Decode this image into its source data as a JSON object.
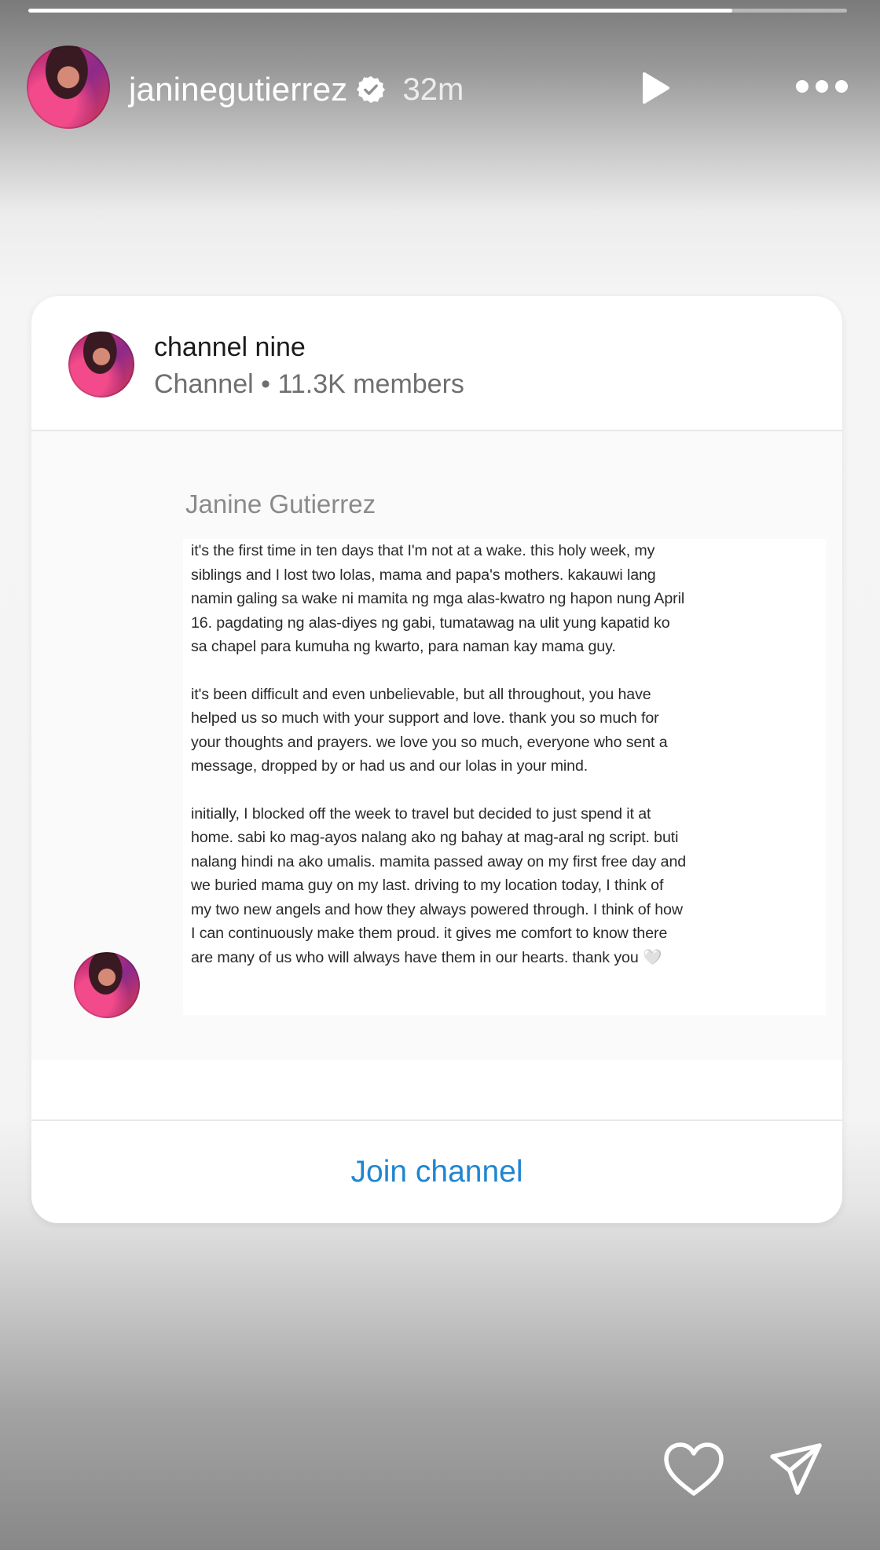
{
  "story": {
    "progress": 0.86,
    "username": "janinegutierrez",
    "verified": true,
    "time": "32m",
    "controls": {
      "play_icon": "play-icon",
      "more_icon": "more-icon"
    }
  },
  "card": {
    "channel_name": "channel nine",
    "channel_meta": "Channel • 11.3K members",
    "post": {
      "author": "Janine Gutierrez",
      "paragraph1_lines": [
        "it's the first time in ten days that I'm not at a wake. this holy week, my",
        "siblings and I lost two lolas, mama and papa's mothers. kakauwi lang",
        "namin galing sa wake ni mamita ng mga alas-kwatro ng hapon nung April",
        "16. pagdating ng alas-diyes ng gabi, tumatawag na ulit yung kapatid ko",
        "sa chapel para kumuha ng kwarto, para naman kay mama guy."
      ],
      "paragraph2_lines": [
        "it's been difficult and even unbelievable, but all throughout, you have",
        "helped us so much with your support and love. thank you so much for",
        "your thoughts and prayers. we love you so much, everyone who sent a",
        "message, dropped by or had us and our lolas in your mind."
      ],
      "paragraph3_lines": [
        "initially, I blocked off the week to travel but decided to just spend it at",
        "home. sabi ko mag-ayos nalang ako ng bahay at mag-aral ng script. buti",
        "nalang hindi na ako umalis. mamita passed away on my first free day and",
        "we buried mama guy on my last. driving to my location today, I think of",
        "my two new angels and how they always powered through. I think of how",
        "I can continuously make them proud. it gives me comfort to know there",
        "are many of us who will always have them in our hearts. thank you 🤍"
      ]
    },
    "join_label": "Join channel"
  },
  "footer": {
    "like_icon": "heart-icon",
    "share_icon": "send-icon"
  },
  "colors": {
    "accent": "#1f86d1",
    "text": "#1a1a1a",
    "muted": "#6f6f6f"
  }
}
